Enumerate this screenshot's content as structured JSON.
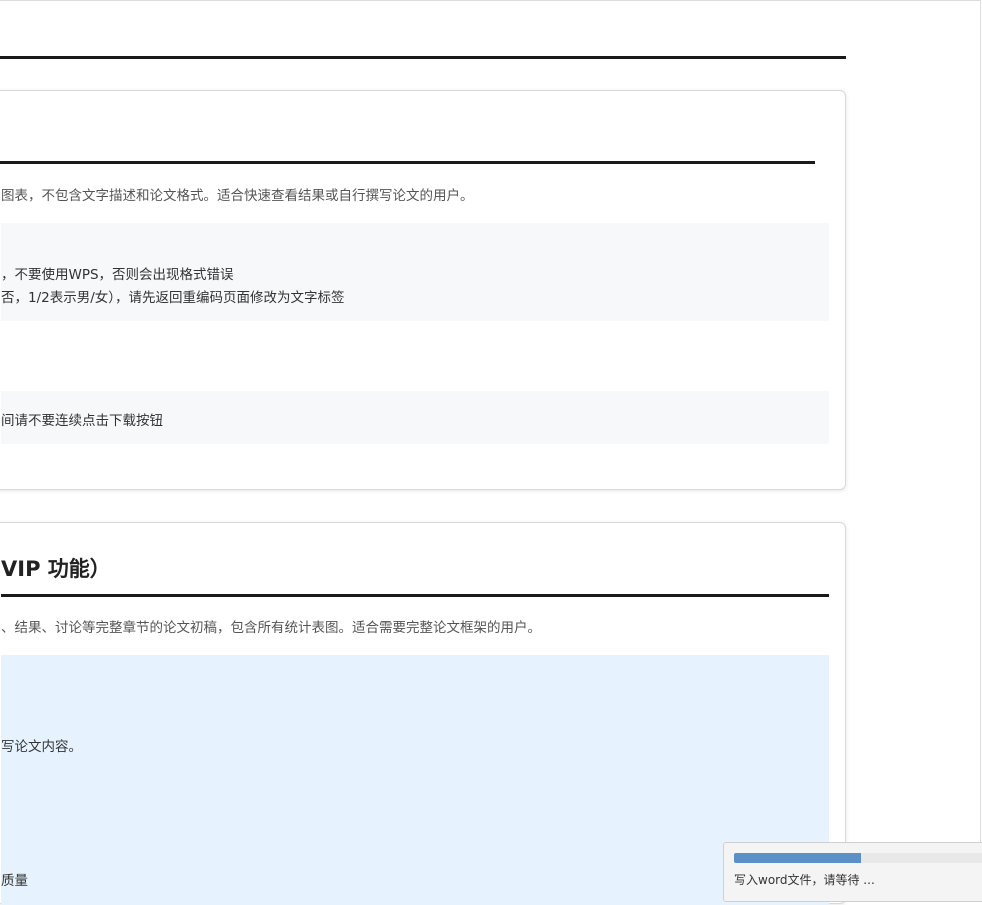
{
  "card1": {
    "description": "图表，不包含文字描述和论文格式。适合快速查看结果或自行撰写论文的用户。",
    "notes": [
      "，不要使用WPS，否则会出现格式错误",
      "否，1/2表示男/女），请先返回重编码页面修改为文字标签"
    ],
    "note2": "间请不要连续点击下载按钮"
  },
  "card2": {
    "title": "VIP 功能）",
    "description": "、结果、讨论等完整章节的论文初稿，包含所有统计表图。适合需要完整论文框架的用户。",
    "line1": "写论文内容。",
    "line2": "质量"
  },
  "progress": {
    "fraction": 0.49,
    "text": "写入word文件，请等待 ..."
  },
  "colors": {
    "note_bg": "#f7f8fa",
    "vip_bg": "#e6f3fe",
    "progress_fill": "#5b8fc7"
  }
}
